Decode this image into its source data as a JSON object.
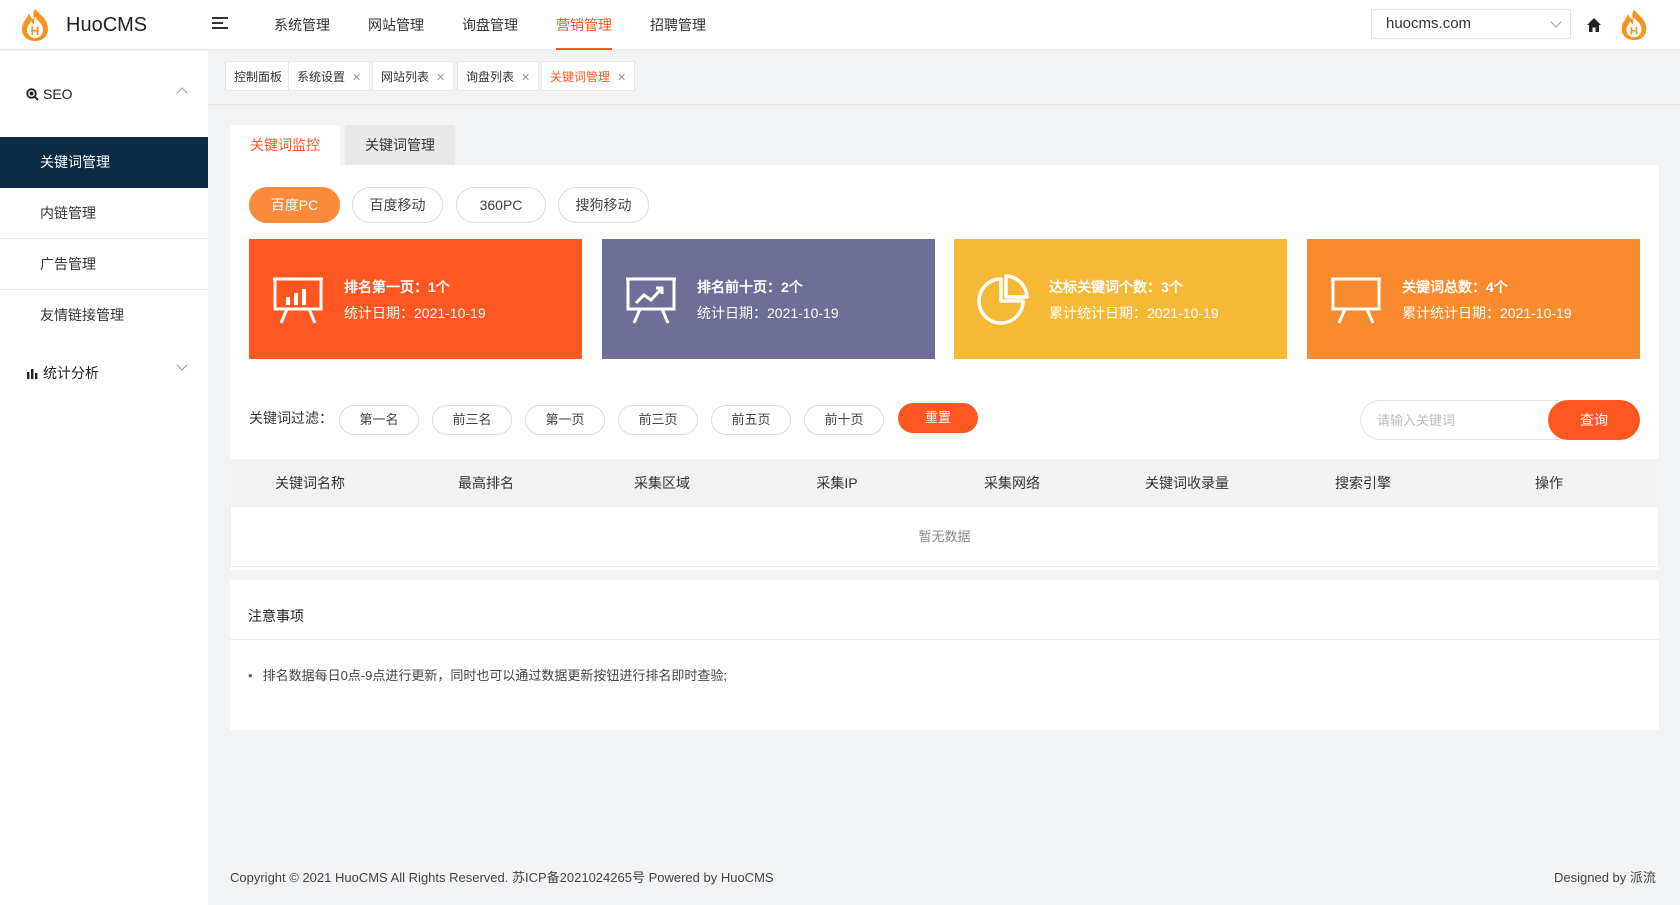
{
  "header": {
    "brand": "HuoCMS",
    "nav": [
      "系统管理",
      "网站管理",
      "询盘管理",
      "营销管理",
      "招聘管理"
    ],
    "active_nav": "营销管理",
    "site_select_value": "huocms.com"
  },
  "sidebar": {
    "seo_label": "SEO",
    "items": [
      "关键词管理",
      "内链管理",
      "广告管理",
      "友情链接管理"
    ],
    "stats_label": "统计分析"
  },
  "tabs": [
    "控制面板",
    "系统设置",
    "网站列表",
    "询盘列表",
    "关键词管理"
  ],
  "subtabs": [
    "关键词监控",
    "关键词管理"
  ],
  "engines": [
    "百度PC",
    "百度移动",
    "360PC",
    "搜狗移动"
  ],
  "stats": [
    {
      "title": "排名第一页：1个",
      "date": "统计日期：2021-10-19",
      "color": "#ff5722",
      "icon": "presentation-chart-icon"
    },
    {
      "title": "排名前十页：2个",
      "date": "统计日期：2021-10-19",
      "color": "#6e6e98",
      "icon": "trend-board-icon"
    },
    {
      "title": "达标关键词个数：3个",
      "date": "累计统计日期：2021-10-19",
      "color": "#f6b936",
      "icon": "pie-chart-icon"
    },
    {
      "title": "关键词总数：4个",
      "date": "累计统计日期：2021-10-19",
      "color": "#fa8a2e",
      "icon": "board-icon"
    }
  ],
  "filter": {
    "label": "关键词过滤：",
    "buttons": [
      "第一名",
      "前三名",
      "第一页",
      "前三页",
      "前五页",
      "前十页"
    ],
    "reset": "重置",
    "search_placeholder": "请输入关键词",
    "search_button": "查询"
  },
  "table": {
    "headers": [
      "关键词名称",
      "最高排名",
      "采集区域",
      "采集IP",
      "采集网络",
      "关键词收录量",
      "搜索引擎",
      "操作"
    ],
    "empty_text": "暂无数据"
  },
  "notes": {
    "title": "注意事项",
    "items": [
      "排名数据每日0点-9点进行更新，同时也可以通过数据更新按钮进行排名即时查验;"
    ]
  },
  "footer": {
    "left": "Copyright © 2021 HuoCMS All Rights Reserved. 苏ICP备2021024265号 Powered by HuoCMS",
    "right": "Designed by 派流"
  }
}
